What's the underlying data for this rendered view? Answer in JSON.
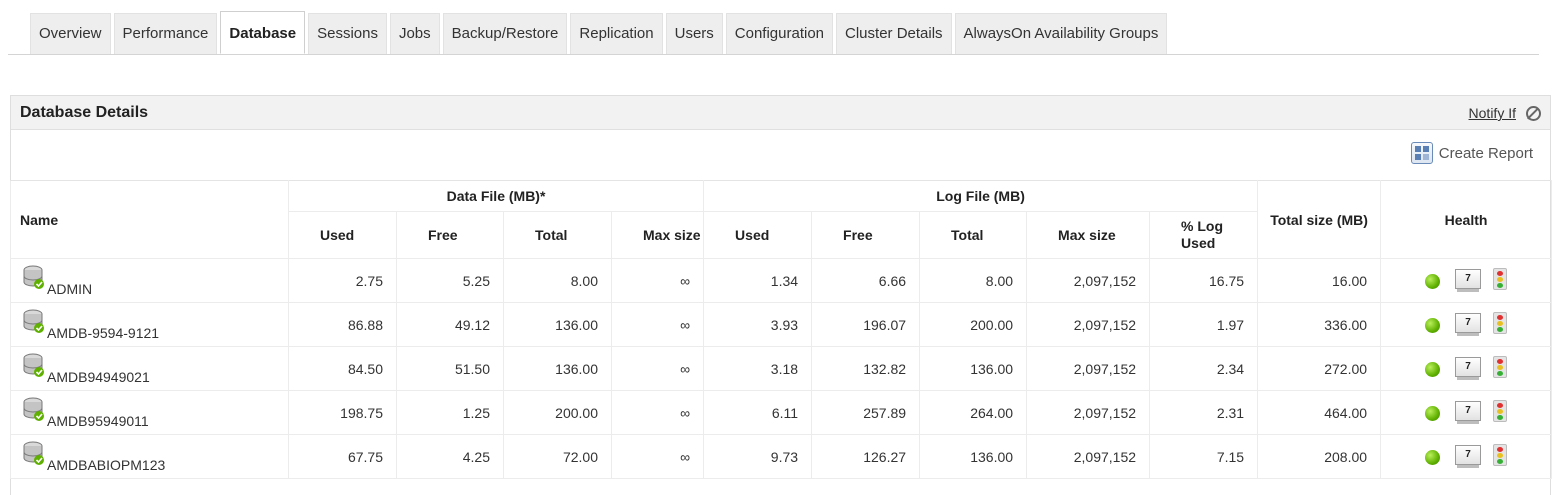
{
  "tabs": [
    {
      "label": "Overview"
    },
    {
      "label": "Performance"
    },
    {
      "label": "Database",
      "active": true
    },
    {
      "label": "Sessions"
    },
    {
      "label": "Jobs"
    },
    {
      "label": "Backup/Restore"
    },
    {
      "label": "Replication"
    },
    {
      "label": "Users"
    },
    {
      "label": "Configuration"
    },
    {
      "label": "Cluster Details"
    },
    {
      "label": "AlwaysOn Availability Groups"
    }
  ],
  "panel": {
    "title": "Database Details",
    "notify_label": "Notify If",
    "notify_icon": "block-icon",
    "report_label": "Create Report",
    "report_icon": "report-icon"
  },
  "table": {
    "name_header": "Name",
    "data_group": "Data File (MB)*",
    "log_group": "Log File (MB)",
    "total_header": "Total size (MB)",
    "health_header": "Health",
    "data_cols": [
      "Used",
      "Free",
      "Total",
      "Max size"
    ],
    "log_cols": [
      "Used",
      "Free",
      "Total",
      "Max size",
      "% Log Used"
    ],
    "history_icon_label": "7",
    "rows": [
      {
        "name": "ADMIN",
        "d_used": "2.75",
        "d_free": "5.25",
        "d_total": "8.00",
        "d_max": "∞",
        "l_used": "1.34",
        "l_free": "6.66",
        "l_total": "8.00",
        "l_max": "2,097,152",
        "l_pct": "16.75",
        "total": "16.00",
        "status_color": "#5fb000"
      },
      {
        "name": "AMDB-9594-9121",
        "d_used": "86.88",
        "d_free": "49.12",
        "d_total": "136.00",
        "d_max": "∞",
        "l_used": "3.93",
        "l_free": "196.07",
        "l_total": "200.00",
        "l_max": "2,097,152",
        "l_pct": "1.97",
        "total": "336.00",
        "status_color": "#5fb000"
      },
      {
        "name": "AMDB94949021",
        "d_used": "84.50",
        "d_free": "51.50",
        "d_total": "136.00",
        "d_max": "∞",
        "l_used": "3.18",
        "l_free": "132.82",
        "l_total": "136.00",
        "l_max": "2,097,152",
        "l_pct": "2.34",
        "total": "272.00",
        "status_color": "#5fb000"
      },
      {
        "name": "AMDB95949011",
        "d_used": "198.75",
        "d_free": "1.25",
        "d_total": "200.00",
        "d_max": "∞",
        "l_used": "6.11",
        "l_free": "257.89",
        "l_total": "264.00",
        "l_max": "2,097,152",
        "l_pct": "2.31",
        "total": "464.00",
        "status_color": "#5fb000"
      },
      {
        "name": "AMDBABIOPM123",
        "d_used": "67.75",
        "d_free": "4.25",
        "d_total": "72.00",
        "d_max": "∞",
        "l_used": "9.73",
        "l_free": "126.27",
        "l_total": "136.00",
        "l_max": "2,097,152",
        "l_pct": "7.15",
        "total": "208.00",
        "status_color": "#5fb000"
      }
    ]
  }
}
